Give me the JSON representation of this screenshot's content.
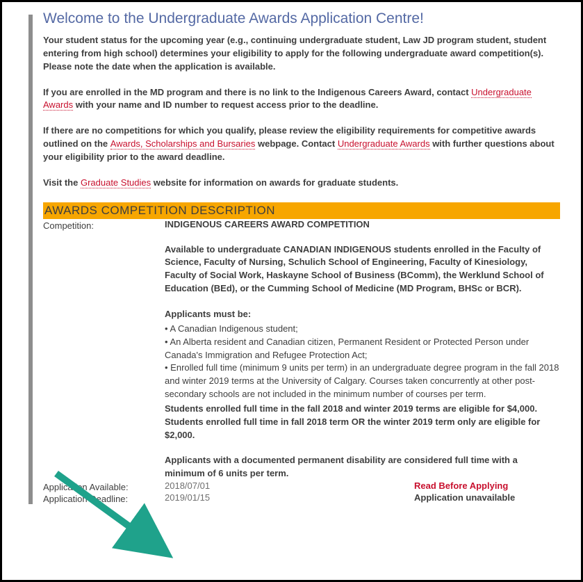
{
  "page_title": "Welcome to the Undergraduate Awards Application Centre!",
  "intro": {
    "p1": "Your student status for the upcoming year (e.g., continuing undergraduate student, Law JD program student, student entering from high school) determines your eligibility to apply for the following undergraduate award competition(s). Please note the date when the application is available.",
    "p2_pre": "If you are enrolled in the MD program and there is no link to the Indigenous Careers Award, contact ",
    "p2_link": "Undergraduate Awards",
    "p2_post": " with your name and ID number to request access prior to the deadline.",
    "p3_pre": "If there are no competitions for which you qualify, please review the eligibility requirements for competitive awards outlined on the ",
    "p3_link1": "Awards, Scholarships and Bursaries",
    "p3_mid": " webpage. Contact ",
    "p3_link2": "Undergraduate Awards",
    "p3_post": " with further questions about your eligibility prior to the award deadline.",
    "p4_pre": "Visit the ",
    "p4_link": "Graduate Studies",
    "p4_post": " website for information on awards for graduate students."
  },
  "section_header": "AWARDS COMPETITION DESCRIPTION",
  "labels": {
    "competition": "Competition:",
    "app_available": "Application Available:",
    "app_deadline": "Application Deadline:"
  },
  "competition": {
    "name": "INDIGENOUS CAREERS AWARD COMPETITION",
    "eligibility_intro": "Available to undergraduate CANADIAN INDIGENOUS students enrolled in the Faculty of Science, Faculty of Nursing, Schulich School of Engineering, Faculty of Kinesiology, Faculty of Social Work, Haskayne School of Business (BComm), the Werklund School of Education (BEd), or the Cumming School of Medicine (MD Program, BHSc or BCR).",
    "mustbe_label": "Applicants must be:",
    "criteria": [
      "A Canadian Indigenous student;",
      "An Alberta resident and Canadian citizen, Permanent Resident or Protected Person under Canada's Immigration and Refugee Protection Act;",
      "Enrolled full time (minimum 9 units per term) in an undergraduate degree program in the fall 2018 and winter 2019 terms at the University of Calgary. Courses taken concurrently at other post-secondary schools are not included in the minimum number of courses per term."
    ],
    "amounts": "Students enrolled full time in the fall 2018 and winter 2019 terms are eligible for $4,000. Students enrolled full time in fall 2018 term OR the winter 2019 term only are eligible for $2,000.",
    "disability_note": "Applicants with a documented permanent disability are considered full time with a minimum of 6 units per term.",
    "available_date": "2018/07/01",
    "deadline_date": "2019/01/15",
    "read_before": "Read Before Applying",
    "status": "Application unavailable"
  },
  "annotation": {
    "arrow_color": "#1fa28b"
  }
}
